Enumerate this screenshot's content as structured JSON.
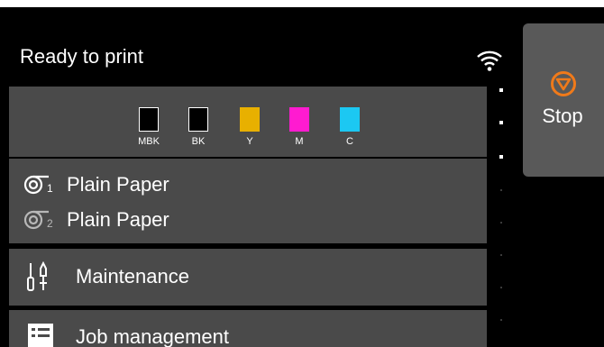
{
  "status": {
    "title": "Ready to print",
    "wifi_icon": "wifi-icon"
  },
  "inks": [
    {
      "label": "MBK",
      "color": "#000000"
    },
    {
      "label": "BK",
      "color": "#000000"
    },
    {
      "label": "Y",
      "color": "#e8b000"
    },
    {
      "label": "M",
      "color": "#ff1bd0"
    },
    {
      "label": "C",
      "color": "#1cc8f2"
    }
  ],
  "paper": {
    "roll1": {
      "label": "Plain Paper",
      "icon": "roll-paper-1-icon"
    },
    "roll2": {
      "label": "Plain Paper",
      "icon": "roll-paper-2-icon"
    }
  },
  "menu": {
    "maintenance": {
      "label": "Maintenance",
      "icon": "maintenance-tools-icon"
    },
    "job_management": {
      "label": "Job management",
      "icon": "job-list-icon"
    }
  },
  "stop_button": {
    "label": "Stop",
    "icon": "stop-icon",
    "icon_color": "#f07a1a"
  }
}
